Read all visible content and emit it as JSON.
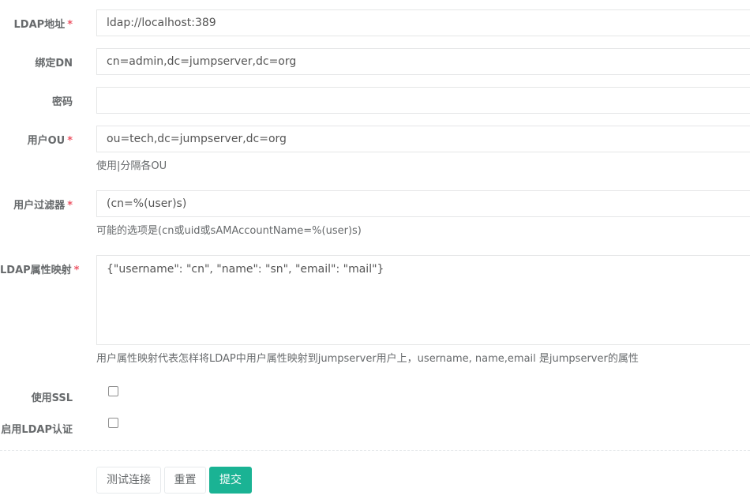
{
  "form": {
    "ldap_url": {
      "label": "LDAP地址",
      "required_mark": "*",
      "value": "ldap://localhost:389"
    },
    "bind_dn": {
      "label": "绑定DN",
      "value": "cn=admin,dc=jumpserver,dc=org"
    },
    "password": {
      "label": "密码",
      "value": ""
    },
    "user_ou": {
      "label": "用户OU",
      "required_mark": "*",
      "value": "ou=tech,dc=jumpserver,dc=org",
      "help": "使用|分隔各OU"
    },
    "user_filter": {
      "label": "用户过滤器",
      "required_mark": "*",
      "value": "(cn=%(user)s)",
      "help": "可能的选项是(cn或uid或sAMAccountName=%(user)s)"
    },
    "attr_map": {
      "label": "LDAP属性映射",
      "required_mark": "*",
      "value": "{\"username\": \"cn\", \"name\": \"sn\", \"email\": \"mail\"}",
      "help": "用户属性映射代表怎样将LDAP中用户属性映射到jumpserver用户上，username, name,email 是jumpserver的属性"
    },
    "use_ssl": {
      "label": "使用SSL",
      "checked": false
    },
    "enable_ldap": {
      "label": "启用LDAP认证",
      "checked": false
    }
  },
  "buttons": {
    "test": "测试连接",
    "reset": "重置",
    "submit": "提交"
  },
  "colors": {
    "primary": "#1ab394",
    "required": "#ed5565"
  }
}
